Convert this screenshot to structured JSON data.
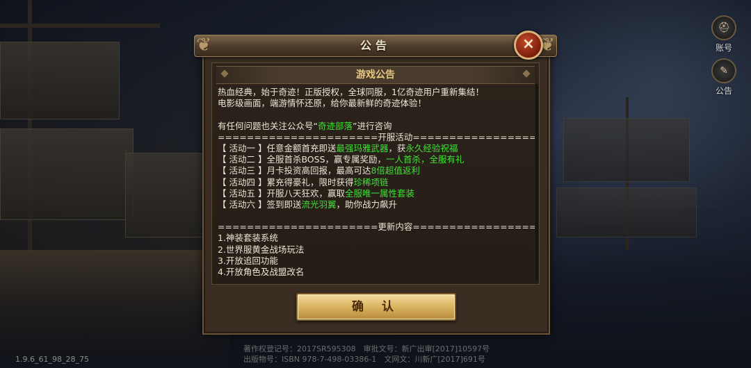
{
  "dialog": {
    "title": "公告",
    "close_icon": "×",
    "header": "游戏公告",
    "confirm_label": "确 认",
    "lines": [
      [
        {
          "t": "热血经典，始于奇迹！正版授权，全球同服，1亿奇迹用户重新集结！"
        }
      ],
      [
        {
          "t": "电影级画面，端游情怀还原，给你最新鲜的奇迹体验！"
        }
      ],
      [
        {
          "t": ""
        }
      ],
      [
        {
          "t": "有任何问题也关注公众号“"
        },
        {
          "t": "奇迹部落",
          "green": true
        },
        {
          "t": "”进行咨询"
        }
      ],
      [
        {
          "t": "======================开服活动======================"
        }
      ],
      [
        {
          "t": "【 活动一 】任意金额首充即送"
        },
        {
          "t": "最强玛雅武器",
          "green": true
        },
        {
          "t": "，获"
        },
        {
          "t": "永久经验祝福",
          "green": true
        }
      ],
      [
        {
          "t": "【 活动二 】全服首杀BOSS，赢专属奖励，"
        },
        {
          "t": "一人首杀，全服有礼",
          "green": true
        }
      ],
      [
        {
          "t": "【 活动三 】月卡投资高回报，最高可达"
        },
        {
          "t": "8倍超值返利",
          "green": true
        }
      ],
      [
        {
          "t": "【 活动四 】累充得豪礼，限时获得"
        },
        {
          "t": "珍稀项链",
          "green": true
        }
      ],
      [
        {
          "t": "【 活动五 】开服八天狂欢，赢取"
        },
        {
          "t": "全服唯一属性套装",
          "green": true
        }
      ],
      [
        {
          "t": "【 活动六 】签到即送"
        },
        {
          "t": "流光羽翼",
          "green": true
        },
        {
          "t": "，助你战力飙升"
        }
      ],
      [
        {
          "t": ""
        }
      ],
      [
        {
          "t": "======================更新内容======================"
        }
      ],
      [
        {
          "t": "1.神装套装系统"
        }
      ],
      [
        {
          "t": "2.世界服黄金战场玩法"
        }
      ],
      [
        {
          "t": "3.开放追回功能"
        }
      ],
      [
        {
          "t": "4.开放角色及战盟改名"
        }
      ]
    ]
  },
  "side_buttons": [
    {
      "label": "账号",
      "icon": "helmet-icon"
    },
    {
      "label": "公告",
      "icon": "notice-icon"
    }
  ],
  "footer": {
    "version": "1.9.6_61_98_28_75",
    "copyright_line1": "著作权登记号：2017SR595308　审批文号：新广出审[2017]10597号",
    "copyright_line2": "出版物号：ISBN 978-7-498-03386-1　文网文：川新广[2017]691号"
  },
  "colors": {
    "highlight_green": "#3fe035",
    "dialog_title": "#f2e6c8",
    "header_gold": "#e8c982"
  }
}
